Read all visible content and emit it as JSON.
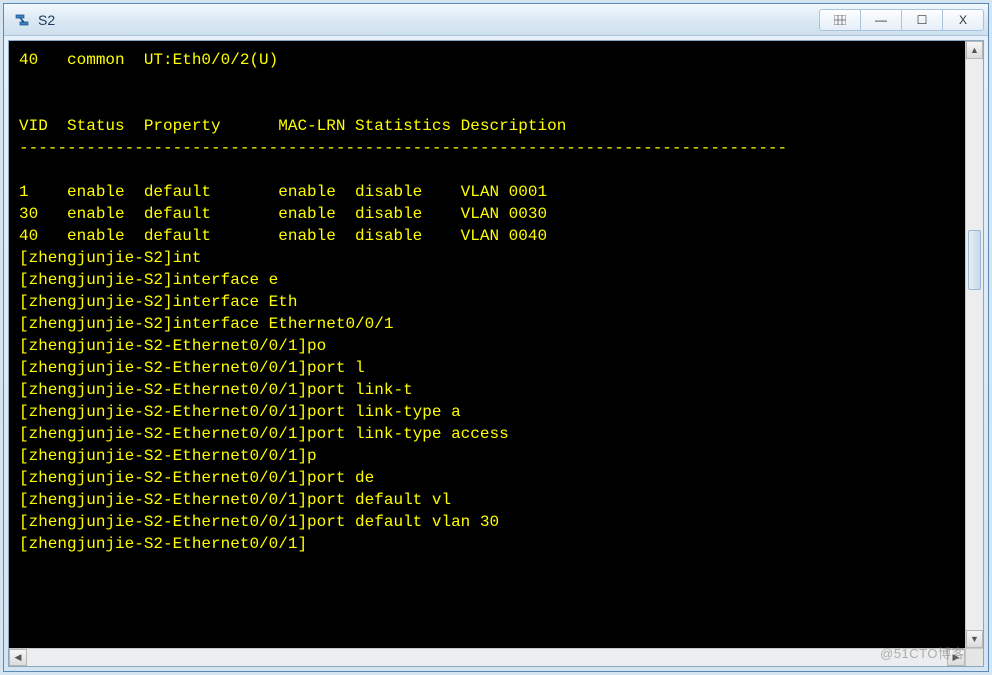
{
  "window": {
    "title": "S2",
    "icon": "network-device-icon"
  },
  "titlebar_buttons": {
    "grid": "grid",
    "minimize": "—",
    "maximize": "☐",
    "close": "X"
  },
  "terminal": {
    "header_line": "40   common  UT:Eth0/0/2(U)",
    "table_header": "VID  Status  Property      MAC-LRN Statistics Description",
    "divider": "--------------------------------------------------------------------------------",
    "rows": [
      "1    enable  default       enable  disable    VLAN 0001",
      "30   enable  default       enable  disable    VLAN 0030",
      "40   enable  default       enable  disable    VLAN 0040"
    ],
    "prompts": [
      "[zhengjunjie-S2]int",
      "[zhengjunjie-S2]interface e",
      "[zhengjunjie-S2]interface Eth",
      "[zhengjunjie-S2]interface Ethernet0/0/1",
      "[zhengjunjie-S2-Ethernet0/0/1]po",
      "[zhengjunjie-S2-Ethernet0/0/1]port l",
      "[zhengjunjie-S2-Ethernet0/0/1]port link-t",
      "[zhengjunjie-S2-Ethernet0/0/1]port link-type a",
      "[zhengjunjie-S2-Ethernet0/0/1]port link-type access",
      "[zhengjunjie-S2-Ethernet0/0/1]p",
      "[zhengjunjie-S2-Ethernet0/0/1]port de",
      "[zhengjunjie-S2-Ethernet0/0/1]port default vl",
      "[zhengjunjie-S2-Ethernet0/0/1]port default vlan 30",
      "[zhengjunjie-S2-Ethernet0/0/1]"
    ]
  },
  "watermark": "@51CTO博客",
  "colors": {
    "terminal_bg": "#000000",
    "terminal_fg": "#ffff00",
    "window_border": "#5a8bb8"
  }
}
